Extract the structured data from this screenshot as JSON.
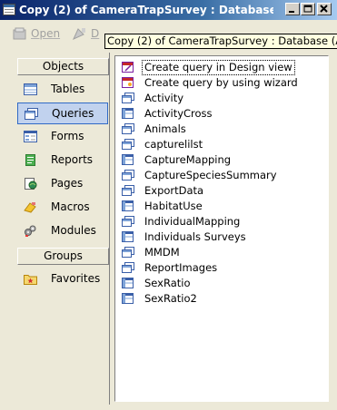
{
  "window": {
    "title": "Copy (2) of CameraTrapSurvey : Database ..."
  },
  "toolbar": {
    "open_label": "Open",
    "design_label": "D"
  },
  "tooltip": {
    "text": "Copy (2) of CameraTrapSurvey : Database (A"
  },
  "objects_pane": {
    "objects_header": "Objects",
    "groups_header": "Groups",
    "items": [
      {
        "label": "Tables",
        "icon": "table-icon"
      },
      {
        "label": "Queries",
        "icon": "query-icon",
        "selected": true
      },
      {
        "label": "Forms",
        "icon": "form-icon"
      },
      {
        "label": "Reports",
        "icon": "report-icon"
      },
      {
        "label": "Pages",
        "icon": "page-icon"
      },
      {
        "label": "Macros",
        "icon": "macro-icon"
      },
      {
        "label": "Modules",
        "icon": "module-icon"
      }
    ],
    "group_items": [
      {
        "label": "Favorites",
        "icon": "favorites-folder-icon"
      }
    ]
  },
  "query_list": {
    "items": [
      {
        "label": "Create query in Design view",
        "icon": "wizard-icon"
      },
      {
        "label": "Create query by using wizard",
        "icon": "wizard-icon"
      },
      {
        "label": "Activity",
        "icon": "select-query-icon"
      },
      {
        "label": "ActivityCross",
        "icon": "crosstab-query-icon"
      },
      {
        "label": "Animals",
        "icon": "select-query-icon"
      },
      {
        "label": "capturelilst",
        "icon": "select-query-icon"
      },
      {
        "label": "CaptureMapping",
        "icon": "crosstab-query-icon"
      },
      {
        "label": "CaptureSpeciesSummary",
        "icon": "select-query-icon"
      },
      {
        "label": "ExportData",
        "icon": "select-query-icon"
      },
      {
        "label": "HabitatUse",
        "icon": "crosstab-query-icon"
      },
      {
        "label": "IndividualMapping",
        "icon": "select-query-icon"
      },
      {
        "label": "Individuals Surveys",
        "icon": "crosstab-query-icon"
      },
      {
        "label": "MMDM",
        "icon": "select-query-icon"
      },
      {
        "label": "ReportImages",
        "icon": "select-query-icon"
      },
      {
        "label": "SexRatio",
        "icon": "crosstab-query-icon"
      },
      {
        "label": "SexRatio2",
        "icon": "crosstab-query-icon"
      }
    ]
  },
  "colors": {
    "title_gradient_start": "#0a246a",
    "selection": "#c1d2ee",
    "selection_border": "#316ac5",
    "tooltip_bg": "#ffffe1"
  }
}
